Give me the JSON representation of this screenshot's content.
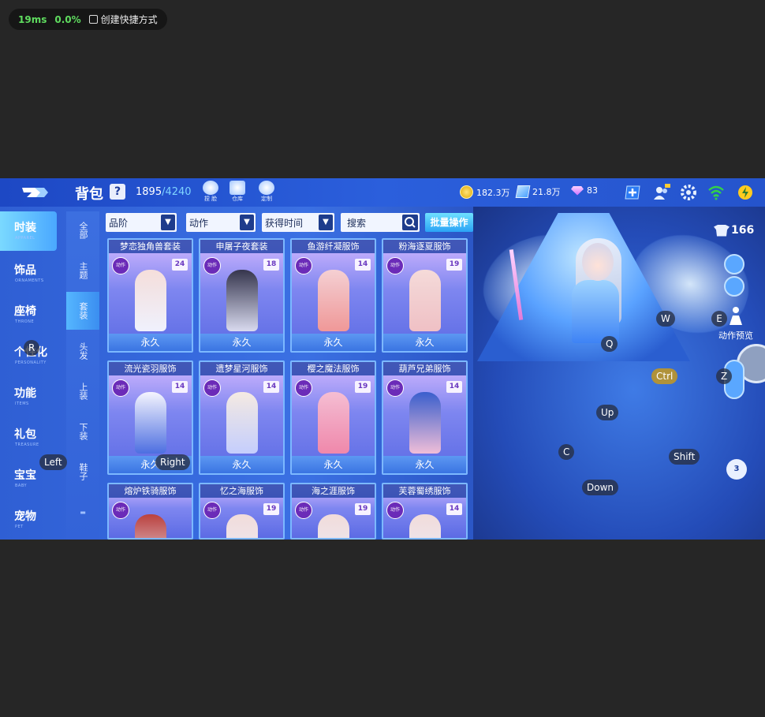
{
  "overlay": {
    "ms": "19ms",
    "percent": "0.0%",
    "shortcut": "创建快捷方式"
  },
  "header": {
    "title": "背包",
    "help": "?",
    "capacity_used": "1895",
    "capacity_max": "/4240",
    "tools": [
      {
        "label": "捏 脸",
        "icon": "face-edit-icon"
      },
      {
        "label": "仓库",
        "icon": "warehouse-icon"
      },
      {
        "label": "定制",
        "icon": "custom-icon"
      }
    ],
    "gold": "182.3万",
    "crystal": "21.8万",
    "diamond": "83"
  },
  "left_nav": [
    {
      "cn": "时装",
      "en": "APPAREL",
      "active": true
    },
    {
      "cn": "饰品",
      "en": "ORNAMENTS"
    },
    {
      "cn": "座椅",
      "en": "THRONE"
    },
    {
      "cn": "个性化",
      "en": "PERSONALITY"
    },
    {
      "cn": "功能",
      "en": "ITEMS"
    },
    {
      "cn": "礼包",
      "en": "TREASURE"
    },
    {
      "cn": "宝宝",
      "en": "BABY"
    },
    {
      "cn": "宠物",
      "en": "PET"
    }
  ],
  "sub_nav": [
    {
      "label": "全部"
    },
    {
      "label": "主题"
    },
    {
      "label": "套装",
      "active": true
    },
    {
      "label": "头发"
    },
    {
      "label": "上装"
    },
    {
      "label": "下装"
    },
    {
      "label": "鞋子"
    },
    {
      "label": "▬"
    }
  ],
  "filters": {
    "quality": "品阶",
    "action": "动作",
    "obtain_time": "获得时间",
    "search_placeholder": "搜索",
    "batch": "批量操作"
  },
  "cards": [
    {
      "name": "梦恋独角兽套装",
      "level": "24",
      "tag": "动作",
      "duration": "永久"
    },
    {
      "name": "申屠子夜套装",
      "level": "18",
      "tag": "动作",
      "duration": "永久"
    },
    {
      "name": "鱼游纤凝服饰",
      "level": "14",
      "tag": "动作",
      "duration": "永久"
    },
    {
      "name": "粉海逐夏服饰",
      "level": "19",
      "tag": "动作",
      "duration": "永久"
    },
    {
      "name": "流光瓷羽服饰",
      "level": "14",
      "tag": "动作",
      "duration": "永久"
    },
    {
      "name": "遗梦星河服饰",
      "level": "14",
      "tag": "动作",
      "duration": "永久"
    },
    {
      "name": "樱之魔法服饰",
      "level": "19",
      "tag": "动作",
      "duration": "永久"
    },
    {
      "name": "葫芦兄弟服饰",
      "level": "14",
      "tag": "动作",
      "duration": "永久"
    },
    {
      "name": "熔炉铁骑服饰",
      "level": "",
      "tag": "动作",
      "duration": ""
    },
    {
      "name": "忆之海服饰",
      "level": "19",
      "tag": "动作",
      "duration": ""
    },
    {
      "name": "海之涯服饰",
      "level": "19",
      "tag": "动作",
      "duration": ""
    },
    {
      "name": "芙蓉蜀绣服饰",
      "level": "14",
      "tag": "动作",
      "duration": ""
    }
  ],
  "character": {
    "level": "166",
    "motion_preview": "动作预览",
    "outfit_count": "3"
  },
  "keys": {
    "r": "R",
    "left": "Left",
    "right": "Right",
    "w": "W",
    "e": "E",
    "q": "Q",
    "ctrl": "Ctrl",
    "z": "Z",
    "up": "Up",
    "c": "C",
    "shift": "Shift",
    "down": "Down"
  }
}
